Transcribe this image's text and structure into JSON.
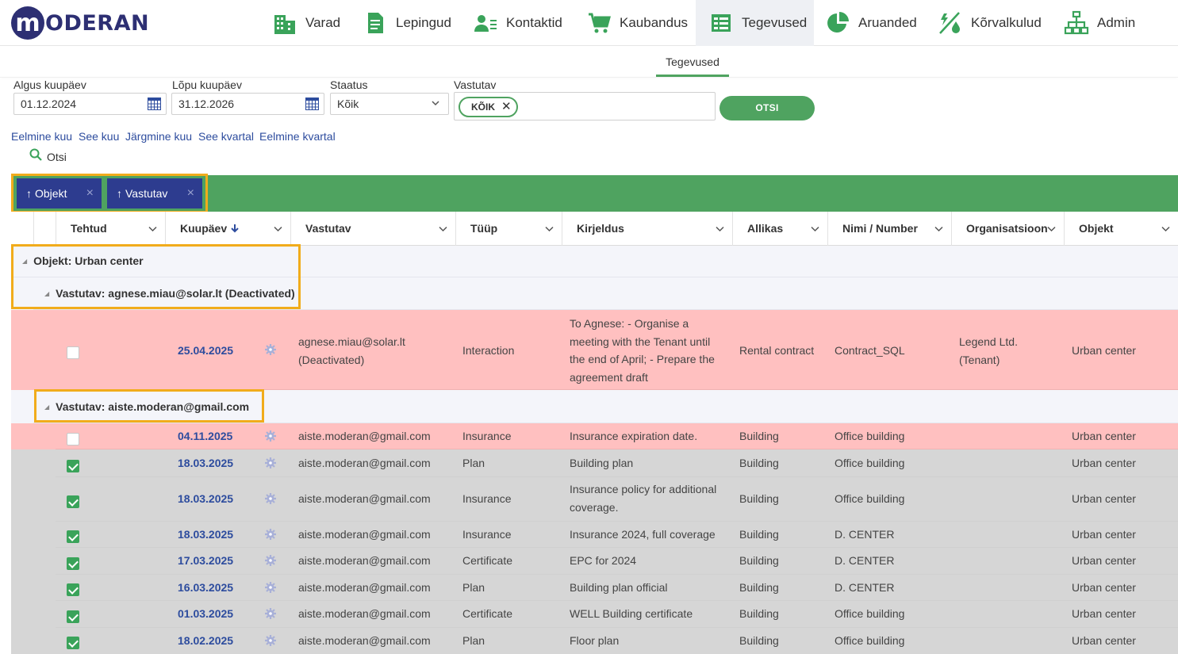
{
  "brand": {
    "logo_letter": "m",
    "logo_text": "ODERAN"
  },
  "nav": [
    {
      "label": "Varad",
      "icon": "building-icon"
    },
    {
      "label": "Lepingud",
      "icon": "document-icon"
    },
    {
      "label": "Kontaktid",
      "icon": "contacts-icon"
    },
    {
      "label": "Kaubandus",
      "icon": "cart-icon"
    },
    {
      "label": "Tegevused",
      "icon": "tasks-icon",
      "active": true
    },
    {
      "label": "Aruanded",
      "icon": "pie-chart-icon"
    },
    {
      "label": "Kõrvalkulud",
      "icon": "utilities-icon"
    },
    {
      "label": "Admin",
      "icon": "org-chart-icon"
    }
  ],
  "subtab": "Tegevused",
  "filters": {
    "start_label": "Algus kuupäev",
    "start_value": "01.12.2024",
    "end_label": "Lõpu kuupäev",
    "end_value": "31.12.2026",
    "status_label": "Staatus",
    "status_value": "Kõik",
    "responsible_label": "Vastutav",
    "responsible_chip": "KÕIK",
    "search_button": "OTSI"
  },
  "quick_links": [
    "Eelmine kuu",
    "See kuu",
    "Järgmine kuu",
    "See kvartal",
    "Eelmine kvartal"
  ],
  "search_link": "Otsi",
  "grouping": [
    {
      "label": "Objekt",
      "arrow": "↑",
      "remove": "×"
    },
    {
      "label": "Vastutav",
      "arrow": "↑",
      "remove": "×"
    }
  ],
  "columns": [
    "Tehtud",
    "Kuupäev",
    "Vastutav",
    "Tüüp",
    "Kirjeldus",
    "Allikas",
    "Nimi / Number",
    "Organisatsioon",
    "Objekt"
  ],
  "groups": {
    "object": "Objekt: Urban center",
    "resp1": "Vastutav: agnese.miau@solar.lt (Deactivated)",
    "resp2": "Vastutav: aiste.moderan@gmail.com"
  },
  "rows": [
    {
      "done": false,
      "date": "25.04.2025",
      "responsible": [
        "agnese.miau@solar.lt",
        "(Deactivated)"
      ],
      "type": "Interaction",
      "description": [
        "To Agnese: - Organise a",
        "meeting with the Tenant until",
        "the end of April; - Prepare the",
        "agreement draft"
      ],
      "source": "Rental contract",
      "name": "Contract_SQL",
      "organisation": [
        "Legend Ltd.",
        "(Tenant)"
      ],
      "object": "Urban center",
      "status": "overdue"
    },
    {
      "done": false,
      "date": "04.11.2025",
      "responsible": [
        "aiste.moderan@gmail.com"
      ],
      "type": "Insurance",
      "description": [
        "Insurance expiration date."
      ],
      "source": "Building",
      "name": "Office building",
      "organisation": [],
      "object": "Urban center",
      "status": "overdue"
    },
    {
      "done": true,
      "date": "18.03.2025",
      "responsible": [
        "aiste.moderan@gmail.com"
      ],
      "type": "Plan",
      "description": [
        "Building plan"
      ],
      "source": "Building",
      "name": "Office building",
      "organisation": [],
      "object": "Urban center",
      "status": "done"
    },
    {
      "done": true,
      "date": "18.03.2025",
      "responsible": [
        "aiste.moderan@gmail.com"
      ],
      "type": "Insurance",
      "description": [
        "Insurance policy for additional",
        "coverage."
      ],
      "source": "Building",
      "name": "Office building",
      "organisation": [],
      "object": "Urban center",
      "status": "done"
    },
    {
      "done": true,
      "date": "18.03.2025",
      "responsible": [
        "aiste.moderan@gmail.com"
      ],
      "type": "Insurance",
      "description": [
        "Insurance 2024, full coverage"
      ],
      "source": "Building",
      "name": "D. CENTER",
      "organisation": [],
      "object": "Urban center",
      "status": "done"
    },
    {
      "done": true,
      "date": "17.03.2025",
      "responsible": [
        "aiste.moderan@gmail.com"
      ],
      "type": "Certificate",
      "description": [
        "EPC for 2024"
      ],
      "source": "Building",
      "name": "D. CENTER",
      "organisation": [],
      "object": "Urban center",
      "status": "done"
    },
    {
      "done": true,
      "date": "16.03.2025",
      "responsible": [
        "aiste.moderan@gmail.com"
      ],
      "type": "Plan",
      "description": [
        "Building plan official"
      ],
      "source": "Building",
      "name": "D. CENTER",
      "organisation": [],
      "object": "Urban center",
      "status": "done"
    },
    {
      "done": true,
      "date": "01.03.2025",
      "responsible": [
        "aiste.moderan@gmail.com"
      ],
      "type": "Certificate",
      "description": [
        "WELL Building certificate"
      ],
      "source": "Building",
      "name": "Office building",
      "organisation": [],
      "object": "Urban center",
      "status": "done"
    },
    {
      "done": true,
      "date": "18.02.2025",
      "responsible": [
        "aiste.moderan@gmail.com"
      ],
      "type": "Plan",
      "description": [
        "Floor plan"
      ],
      "source": "Building",
      "name": "Office building",
      "organisation": [],
      "object": "Urban center",
      "status": "done"
    }
  ],
  "colors": {
    "accent_green": "#4fa360",
    "brand_navy": "#2d2f73",
    "chip_navy": "#2d3c8f",
    "overdue_row": "#ffc0c0",
    "done_row": "#d6d6d6",
    "highlight": "#f1ac1b"
  }
}
